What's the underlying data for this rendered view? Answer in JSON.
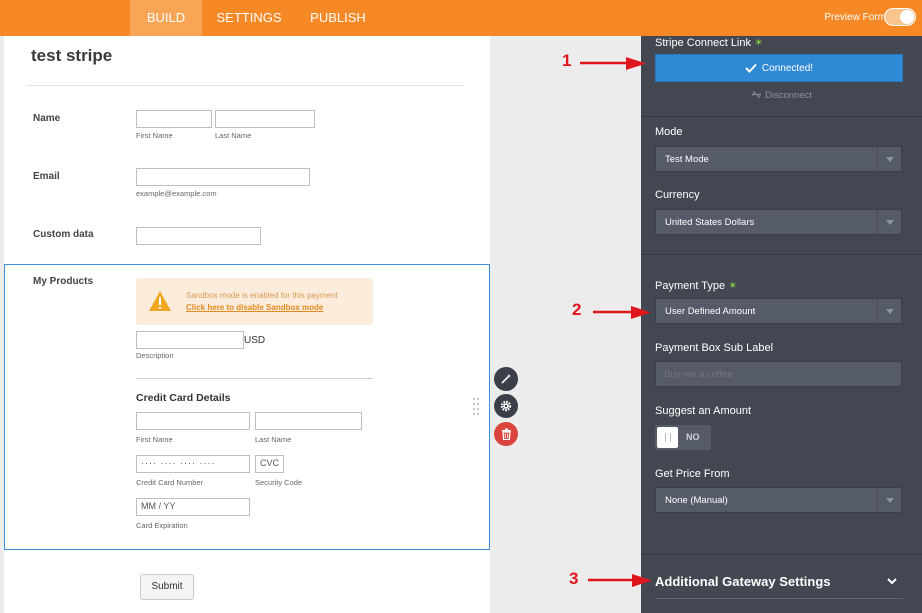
{
  "nav": {
    "tabs": [
      {
        "label": "BUILD",
        "active": true
      },
      {
        "label": "SETTINGS",
        "active": false
      },
      {
        "label": "PUBLISH",
        "active": false
      }
    ],
    "preview_label": "Preview Form",
    "preview_on": false
  },
  "form": {
    "title": "test stripe",
    "name": {
      "label": "Name",
      "first_sub": "First Name",
      "last_sub": "Last Name"
    },
    "email": {
      "label": "Email",
      "sub": "example@example.com"
    },
    "custom": {
      "label": "Custom data"
    },
    "products": {
      "label": "My Products",
      "sandbox_message": "Sandbox mode is enabled for this payment",
      "sandbox_link": "Click here to disable Sandbox mode",
      "currency_suffix": "USD",
      "description_sub": "Description"
    },
    "credit_card": {
      "title": "Credit Card Details",
      "first_sub": "First Name",
      "last_sub": "Last Name",
      "number_placeholder": "···· ···· ···· ····",
      "number_sub": "Credit Card Number",
      "cvc_placeholder": "CVC",
      "cvc_sub": "Security Code",
      "exp_placeholder": "MM  /  YY",
      "exp_sub": "Card Expiration"
    },
    "submit_label": "Submit"
  },
  "panel": {
    "stripe_label": "Stripe Connect Link",
    "connected_label": "Connected!",
    "disconnect_label": "Disconnect",
    "mode": {
      "label": "Mode",
      "value": "Test Mode"
    },
    "currency": {
      "label": "Currency",
      "value": "United States Dollars"
    },
    "payment_type": {
      "label": "Payment Type",
      "value": "User Defined Amount"
    },
    "sublabel": {
      "label": "Payment Box Sub Label",
      "placeholder": "Buy me a coffee"
    },
    "suggest": {
      "label": "Suggest an Amount",
      "value": "NO"
    },
    "price_from": {
      "label": "Get Price From",
      "value": "None (Manual)"
    },
    "additional_label": "Additional Gateway Settings"
  },
  "annotations": [
    "1",
    "2",
    "3"
  ],
  "colors": {
    "brand": "#f68826",
    "accent": "#2f89d4",
    "panel": "#424752",
    "annotation": "#e0161d"
  }
}
